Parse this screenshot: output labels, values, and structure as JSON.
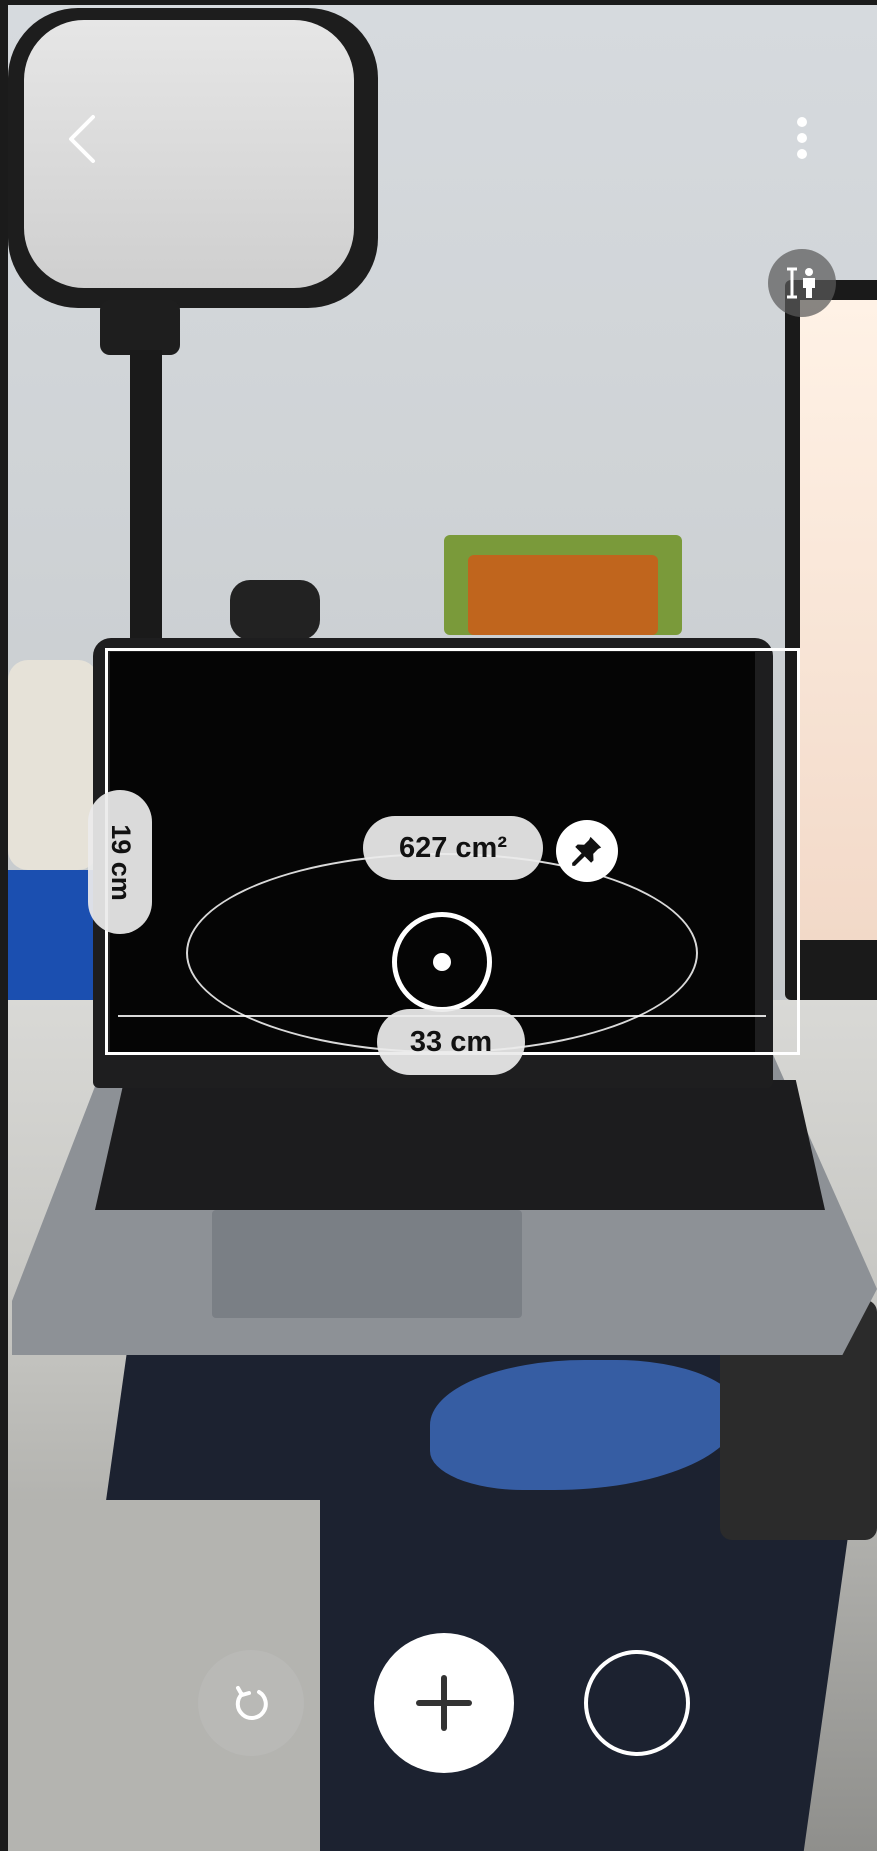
{
  "screen": {
    "app": "AR measure camera view",
    "scene_description_icon": "camera-view"
  },
  "top_bar": {
    "back_icon": "chevron-left-icon",
    "more_icon": "more-vertical-icon",
    "height_mode_icon": "person-height-icon"
  },
  "measurements": {
    "area_label": "627 cm²",
    "width_label": "33 cm",
    "height_label": "19 cm",
    "pin_icon": "pin-icon"
  },
  "bottom_bar": {
    "reset_icon": "reset-icon",
    "add_icon": "plus-icon",
    "shape_icon": "circle-shape-icon"
  },
  "colors": {
    "overlay_line": "#ffffff",
    "label_bg": "#ebebeb",
    "label_text": "#111111"
  }
}
